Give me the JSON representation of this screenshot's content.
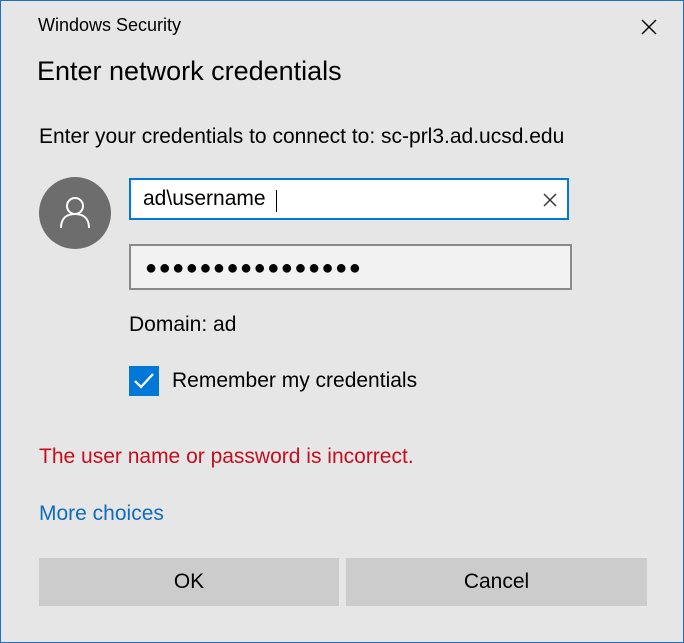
{
  "window": {
    "title": "Windows Security",
    "close_icon": "close-icon",
    "border_color": "#1f6fc5"
  },
  "dialog": {
    "heading": "Enter network credentials",
    "subtitle": "Enter your credentials to connect to: sc-prl3.ad.ucsd.edu",
    "avatar_icon": "user-icon"
  },
  "form": {
    "username": {
      "value": "ad\\username",
      "clear_icon": "clear-icon"
    },
    "password": {
      "masked_value": "●●●●●●●●●●●●●●●●"
    },
    "domain_text": "Domain: ad",
    "remember": {
      "label": "Remember my credentials",
      "checked": true
    }
  },
  "error_message": "The user name or password is incorrect.",
  "more_choices": "More choices",
  "buttons": {
    "ok": "OK",
    "cancel": "Cancel"
  },
  "colors": {
    "accent": "#0078d7",
    "error": "#c50f1f",
    "link": "#0f6cbd",
    "background": "#e6e6e6"
  }
}
